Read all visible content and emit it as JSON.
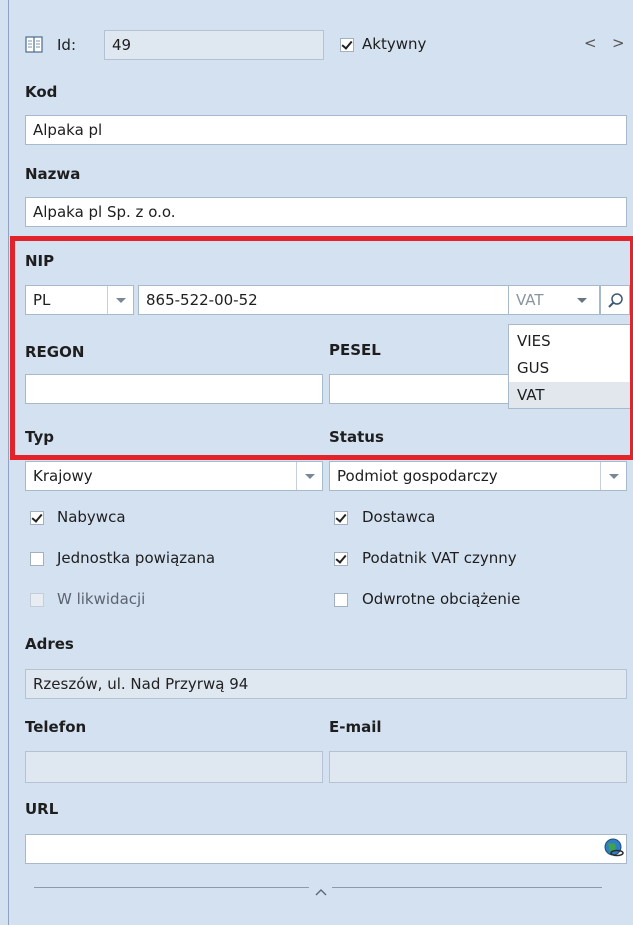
{
  "header": {
    "id_label": "Id:",
    "id_value": "49",
    "active_label": "Aktywny",
    "active_checked": true,
    "prev_arrow": "<",
    "next_arrow": ">"
  },
  "kod": {
    "label": "Kod",
    "value": "Alpaka pl"
  },
  "nazwa": {
    "label": "Nazwa",
    "value": "Alpaka pl Sp. z o.o."
  },
  "nip": {
    "label": "NIP",
    "country": "PL",
    "value": "865-522-00-52",
    "source": "VAT",
    "source_options": [
      "VIES",
      "GUS",
      "VAT"
    ]
  },
  "regon": {
    "label": "REGON",
    "value": ""
  },
  "pesel": {
    "label": "PESEL",
    "value": ""
  },
  "typ": {
    "label": "Typ",
    "value": "Krajowy"
  },
  "status": {
    "label": "Status",
    "value": "Podmiot gospodarczy"
  },
  "checkboxes": {
    "nabywca": {
      "label": "Nabywca",
      "checked": true,
      "enabled": true
    },
    "dostawca": {
      "label": "Dostawca",
      "checked": true,
      "enabled": true
    },
    "jednostka": {
      "label": "Jednostka powiązana",
      "checked": false,
      "enabled": true
    },
    "podatnik": {
      "label": "Podatnik VAT czynny",
      "checked": true,
      "enabled": true
    },
    "likwidacja": {
      "label": "W likwidacji",
      "checked": false,
      "enabled": false
    },
    "odwrotne": {
      "label": "Odwrotne obciążenie",
      "checked": false,
      "enabled": true
    }
  },
  "adres": {
    "label": "Adres",
    "value": "Rzeszów, ul. Nad Przyrwą  94"
  },
  "telefon": {
    "label": "Telefon",
    "value": ""
  },
  "email": {
    "label": "E-mail",
    "value": ""
  },
  "url": {
    "label": "URL",
    "value": ""
  },
  "colors": {
    "highlight": "#e3232a",
    "background": "#d4e1f1"
  }
}
